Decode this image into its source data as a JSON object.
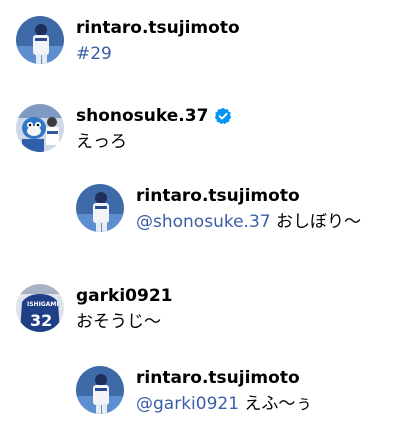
{
  "comments": [
    {
      "username": "rintaro.tsujimoto",
      "hashtag": "#29",
      "avatar_icon": "player-photo-avatar"
    },
    {
      "username": "shonosuke.37",
      "verified": true,
      "text": "えっろ",
      "avatar_icon": "mascot-photo-avatar"
    },
    {
      "username": "rintaro.tsujimoto",
      "mention": "@shonosuke.37",
      "text": " おしぼり〜",
      "avatar_icon": "player-photo-avatar"
    },
    {
      "username": "garki0921",
      "text": "おそうじ〜",
      "avatar_icon": "jersey-photo-avatar"
    },
    {
      "username": "rintaro.tsujimoto",
      "mention": "@garki0921",
      "text": " えふ〜ぅ",
      "avatar_icon": "player-photo-avatar"
    }
  ],
  "colors": {
    "link": "#3b5da7",
    "verified": "#0095f6",
    "text": "#000000"
  }
}
